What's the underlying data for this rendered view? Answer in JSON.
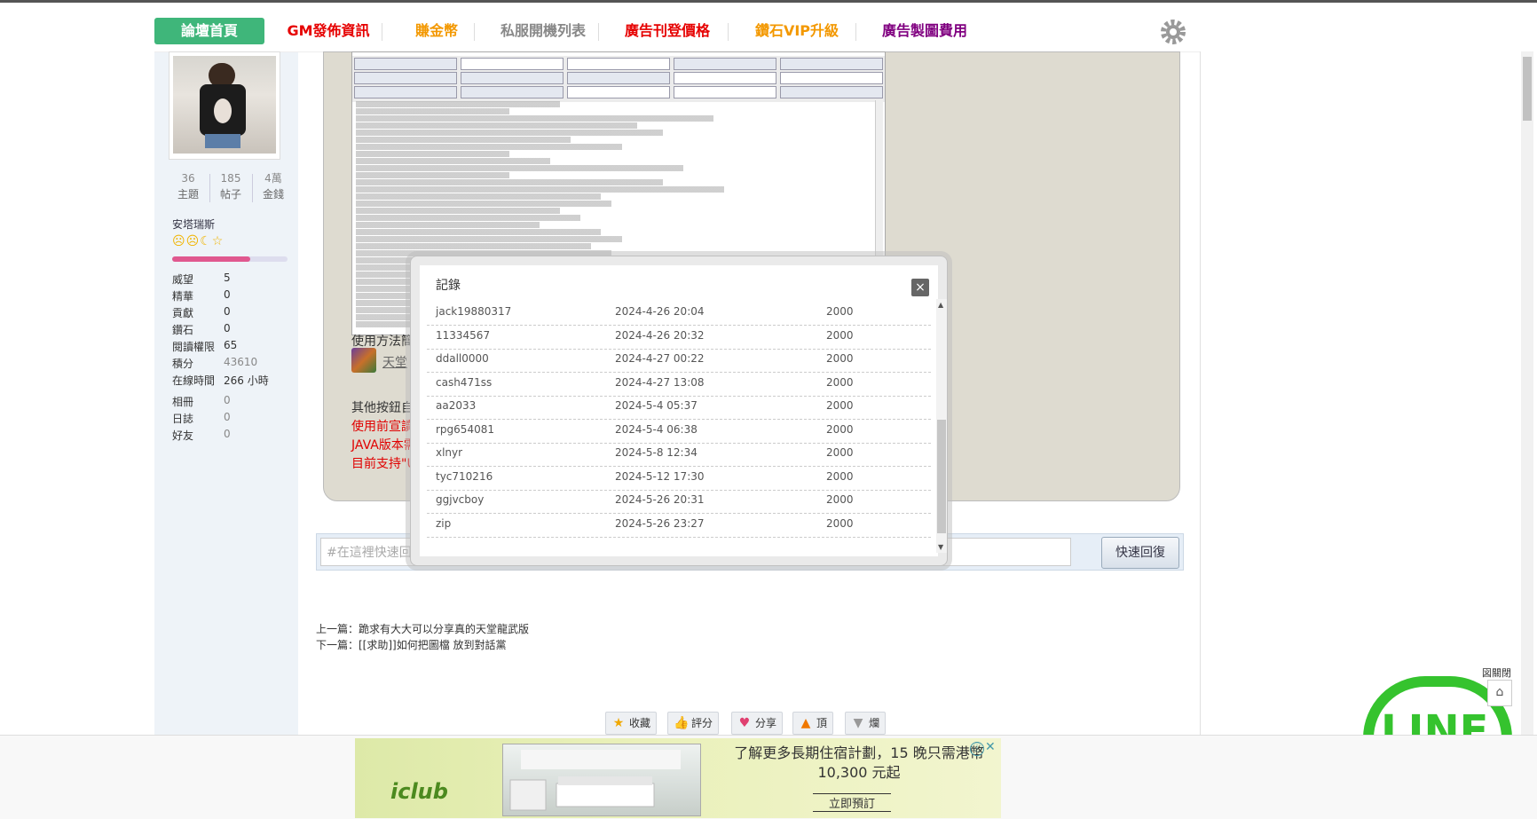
{
  "nav": {
    "items": [
      {
        "label": "論壇首頁",
        "color": "#ffffff"
      },
      {
        "label": "GM發佈資訊",
        "color": "#e60000"
      },
      {
        "label": "賺金幣",
        "color": "#f39800"
      },
      {
        "label": "私服開機列表",
        "color": "#888888"
      },
      {
        "label": "廣告刊登價格",
        "color": "#e60000"
      },
      {
        "label": "鑽石VIP升級",
        "color": "#f39800"
      },
      {
        "label": "廣告製圖費用",
        "color": "#800080"
      }
    ]
  },
  "profile": {
    "stats": [
      {
        "value": "36",
        "label": "主題"
      },
      {
        "value": "185",
        "label": "帖子"
      },
      {
        "value": "4萬",
        "label": "金錢"
      }
    ],
    "username": "安塔瑞斯",
    "rank_icons": "☹☹☾☆",
    "rank_progress": 0.68,
    "props": [
      {
        "label": "威望",
        "value": "5"
      },
      {
        "label": "精華",
        "value": "0"
      },
      {
        "label": "貢獻",
        "value": "0"
      },
      {
        "label": "鑽石",
        "value": "0"
      },
      {
        "label": "閱讀權限",
        "value": "65"
      },
      {
        "label": "積分",
        "value": "43610"
      },
      {
        "label": "在線時間",
        "value": "266 小時"
      }
    ],
    "props2": [
      {
        "label": "相冊",
        "value": "0"
      },
      {
        "label": "日誌",
        "value": "0"
      },
      {
        "label": "好友",
        "value": "0"
      }
    ]
  },
  "post": {
    "usage_text": "使用方法簡",
    "archive_link": "天堂",
    "other_text": "其他按鈕自",
    "red_lines": [
      "使用前宣讀",
      "JAVA版本需",
      "目前支持\"UT"
    ]
  },
  "reply": {
    "placeholder": "#在這裡快速回覆",
    "button": "快速回復"
  },
  "prevnext": {
    "prev": "上一篇：跪求有大大可以分享真的天堂龍武版",
    "next": "下一篇：[[求助]]如何把圖檔 放到對話黨"
  },
  "actions": [
    {
      "label": "收藏",
      "icon": "★"
    },
    {
      "label": "評分",
      "icon": "👍"
    },
    {
      "label": "分享",
      "icon": "♥"
    },
    {
      "label": "頂",
      "icon": "▲"
    },
    {
      "label": "爛",
      "icon": "▼"
    }
  ],
  "modal": {
    "title": "記錄",
    "close": "×",
    "rows": [
      {
        "user": "jack19880317",
        "time": "2024-4-26 20:04",
        "amount": "2000"
      },
      {
        "user": "11334567",
        "time": "2024-4-26 20:32",
        "amount": "2000"
      },
      {
        "user": "ddall0000",
        "time": "2024-4-27 00:22",
        "amount": "2000"
      },
      {
        "user": "cash471ss",
        "time": "2024-4-27 13:08",
        "amount": "2000"
      },
      {
        "user": "aa2033",
        "time": "2024-5-4 05:37",
        "amount": "2000"
      },
      {
        "user": "rpg654081",
        "time": "2024-5-4 06:38",
        "amount": "2000"
      },
      {
        "user": "xlnyr",
        "time": "2024-5-8 12:34",
        "amount": "2000"
      },
      {
        "user": "tyc710216",
        "time": "2024-5-12 17:30",
        "amount": "2000"
      },
      {
        "user": "ggjvcboy",
        "time": "2024-5-26 20:31",
        "amount": "2000"
      },
      {
        "user": "zip",
        "time": "2024-5-26 23:27",
        "amount": "2000"
      }
    ]
  },
  "ad": {
    "logo": "iclub",
    "headline": "了解更多長期住宿計劃，15 晚只需港幣 10,300 元起",
    "cta": "立即預訂",
    "info_icon": "ⓘ",
    "close_icon": "✕"
  },
  "floating": {
    "close_label": "図關閉",
    "close_icon": "⌂",
    "line_logo": "LINE"
  },
  "colors": {
    "accent_green": "#3fb67a",
    "modal_bg": "#eaeaea",
    "line_green": "#35c32e"
  }
}
